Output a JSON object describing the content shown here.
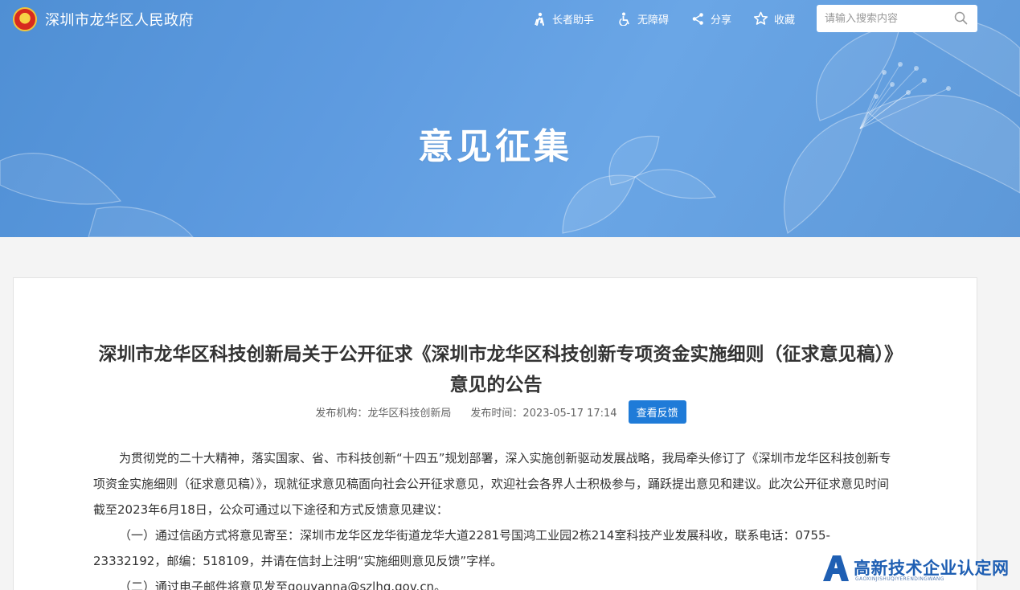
{
  "header": {
    "site_title": "深圳市龙华区人民政府",
    "logo_icon": "national-emblem-icon",
    "tools": [
      {
        "label": "长者助手",
        "icon": "elder-assistant-icon"
      },
      {
        "label": "无障碍",
        "icon": "accessibility-icon"
      },
      {
        "label": "分享",
        "icon": "share-icon"
      },
      {
        "label": "收藏",
        "icon": "star-icon"
      }
    ],
    "search": {
      "placeholder": "请输入搜索内容",
      "value": "",
      "icon": "search-icon"
    }
  },
  "banner": {
    "title": "意见征集"
  },
  "article": {
    "title": "深圳市龙华区科技创新局关于公开征求《深圳市龙华区科技创新专项资金实施细则（征求意见稿）》意见的公告",
    "meta": {
      "publisher_label": "发布机构：龙华区科技创新局",
      "publish_time_label": "发布时间：2023-05-17 17:14",
      "feedback_button": "查看反馈"
    },
    "paragraphs": [
      "为贯彻党的二十大精神，落实国家、省、市科技创新“十四五”规划部署，深入实施创新驱动发展战略，我局牵头修订了《深圳市龙华区科技创新专项资金实施细则（征求意见稿）》，现就征求意见稿面向社会公开征求意见，欢迎社会各界人士积极参与，踊跃提出意见和建议。此次公开征求意见时间截至2023年6月18日，公众可通过以下途径和方式反馈意见建议：",
      "（一）通过信函方式将意见寄至：深圳市龙华区龙华街道龙华大道2281号国鸿工业园2栋214室科技产业发展科收，联系电话：0755-23332192，邮编：518109，并请在信封上注明“实施细则意见反馈”字样。",
      "（二）通过电子邮件将意见发至gouyanna@szlhq.gov.cn。"
    ]
  },
  "watermark": {
    "title": "高新技术企业认定网",
    "subtitle": "GAOXINJISHUQIYERENDINGWANG"
  },
  "colors": {
    "banner": "#5e9be0",
    "accent": "#1f7bd8",
    "watermark": "#1f5fb3"
  }
}
